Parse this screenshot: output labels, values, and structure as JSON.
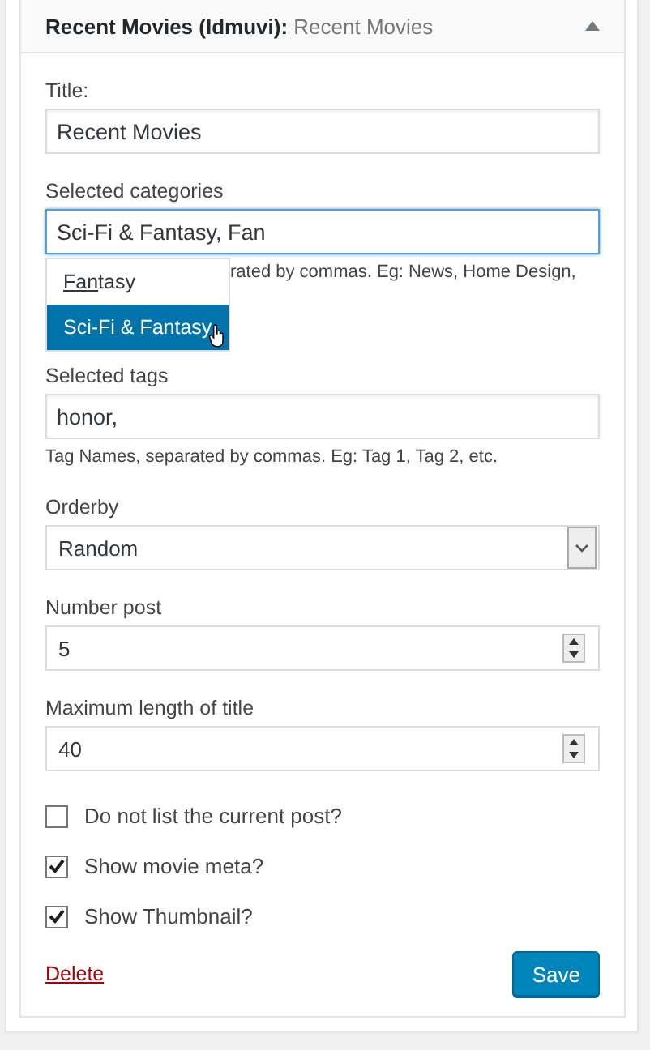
{
  "widget": {
    "title": "Recent Movies (Idmuvi):",
    "subtitle": "Recent Movies",
    "expanded": true
  },
  "title_field": {
    "label": "Title:",
    "value": "Recent Movies"
  },
  "categories_field": {
    "label": "Selected categories",
    "value": "Sci-Fi & Fantasy, Fan",
    "hint": "rated by commas. Eg: News, Home Design,",
    "suggestions": [
      {
        "match": "Fan",
        "rest": "tasy",
        "selected": false
      },
      {
        "rest": "Sci-Fi & Fantasy",
        "selected": true
      }
    ]
  },
  "tags_field": {
    "label": "Selected tags",
    "value": "honor,",
    "hint": "Tag Names, separated by commas. Eg: Tag 1, Tag 2, etc."
  },
  "orderby": {
    "label": "Orderby",
    "value": "Random"
  },
  "number_post": {
    "label": "Number post",
    "value": "5"
  },
  "max_length": {
    "label": "Maximum length of title",
    "value": "40"
  },
  "checkboxes": [
    {
      "label": "Do not list the current post?",
      "checked": false
    },
    {
      "label": "Show movie meta?",
      "checked": true
    },
    {
      "label": "Show Thumbnail?",
      "checked": true
    }
  ],
  "delete_link": "Delete",
  "save_button": "Save"
}
